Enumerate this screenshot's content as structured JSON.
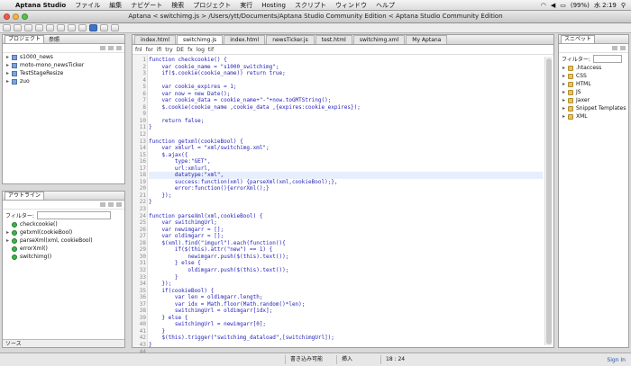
{
  "menubar": {
    "app": "Aptana Studio",
    "items": [
      "ファイル",
      "編集",
      "ナビゲート",
      "検索",
      "プロジェクト",
      "実行",
      "Hosting",
      "スクリプト",
      "ウィンドウ",
      "ヘルプ"
    ],
    "battery": "(99%)",
    "clock": "水 2:19"
  },
  "window": {
    "title": "Aptana < switchimg.js > /Users/ytt/Documents/Aptana Studio Community Edition < Aptana Studio Community Edition"
  },
  "left_top": {
    "tabs": [
      "プロジェクト",
      "参照"
    ],
    "items": [
      {
        "label": "s1000_news",
        "icon": "project-icon"
      },
      {
        "label": "moto-mono_newsTicker",
        "icon": "project-icon"
      },
      {
        "label": "TestStageResize",
        "icon": "project-icon"
      },
      {
        "label": "zuo",
        "icon": "project-icon"
      }
    ]
  },
  "outline": {
    "tab": "アウトライン",
    "filter_label": "フィルター:",
    "items": [
      "checkcookie()",
      "getxml(cookieBool)",
      "parseXml(xml, cookieBool)",
      "errorXml()",
      "switchimg()"
    ],
    "bottom_tab": "ソース"
  },
  "editor": {
    "tabs": [
      "index.html",
      "switchimg.js",
      "index.html",
      "newsTicker.js",
      "test.html",
      "switchimg.xml",
      "My Aptana"
    ],
    "active_tab": 1,
    "toolbar": [
      "fnl",
      "for",
      "ifi",
      "try",
      "DE",
      "fx",
      "log",
      "tif"
    ],
    "code": [
      "function checkcookie() {",
      "    var cookie_name = \"s1000_switchimg\";",
      "    if($.cookie(cookie_name)) return true;",
      "",
      "    var cookie_expires = 1;",
      "    var now = new Date();",
      "    var cookie_data = cookie_name+\"-\"+now.toGMTString();",
      "    $.cookie(cookie_name ,cookie_data ,{expires:cookie_expires});",
      "",
      "    return false;",
      "}",
      "",
      "function getxml(cookieBool) {",
      "    var xmlurl = \"xml/switchimg.xml\";",
      "    $.ajax({",
      "        type:\"GET\",",
      "        url:xmlurl,",
      "        datatype:\"xml\",",
      "        success:function(xml) {parseXml(xml,cookieBool);},",
      "        error:function(){errorXml();}",
      "    });",
      "}",
      "",
      "function parseXml(xml,cookieBool) {",
      "    var switchimgUrl;",
      "    var newimgarr = [];",
      "    var oldimgarr = [];",
      "    $(xml).find(\"imgurl\").each(function(){",
      "        if($(this).attr(\"new\") == 1) {",
      "            newimgarr.push($(this).text());",
      "        } else {",
      "            oldimgarr.push($(this).text());",
      "        }",
      "    });",
      "    if(cookieBool) {",
      "        var len = oldimgarr.length;",
      "        var idx = Math.floor(Math.random()*len);",
      "        switchimgUrl = oldimgarr[idx];",
      "    } else {",
      "        switchimgUrl = newimgarr[0];",
      "    }",
      "    $(this).trigger(\"switchimg_dataload\",[switchimgUrl]);",
      "}",
      "",
      "function switchimg() {"
    ],
    "highlight_line": 18
  },
  "snippets": {
    "tab": "スニペット",
    "filter_label": "フィルター:",
    "items": [
      ".htaccess",
      "CSS",
      "HTML",
      "JS",
      "Jaxer",
      "Snippet Templates",
      "XML"
    ],
    "signin": "Sign In"
  },
  "status": {
    "mode": "書き込み可能",
    "insert": "挿入",
    "position": "18 : 24"
  }
}
